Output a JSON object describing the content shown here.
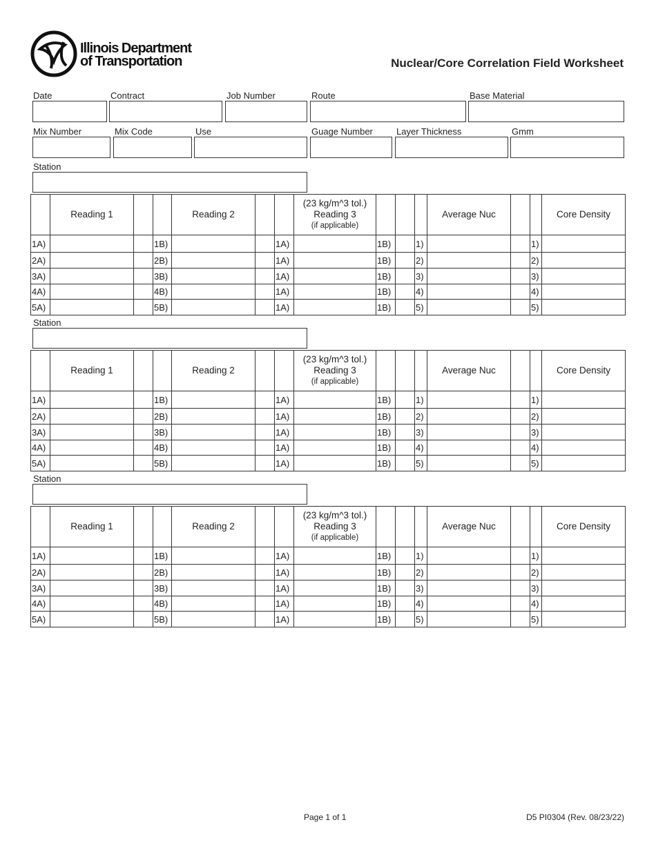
{
  "header": {
    "org_line1": "Illinois Department",
    "org_line2": "of Transportation",
    "title": "Nuclear/Core Correlation Field Worksheet"
  },
  "fields_row1": [
    {
      "label": "Date",
      "value": ""
    },
    {
      "label": "Contract",
      "value": ""
    },
    {
      "label": "Job Number",
      "value": ""
    },
    {
      "label": "Route",
      "value": ""
    },
    {
      "label": "Base Material",
      "value": ""
    }
  ],
  "fields_row2": [
    {
      "label": "Mix Number",
      "value": ""
    },
    {
      "label": "Mix Code",
      "value": ""
    },
    {
      "label": "Use",
      "value": ""
    },
    {
      "label": "Guage Number",
      "value": ""
    },
    {
      "label": "Layer Thickness",
      "value": ""
    },
    {
      "label": "Gmm",
      "value": ""
    }
  ],
  "station_label": "Station",
  "table_headers": {
    "reading1": "Reading 1",
    "reading2": "Reading 2",
    "reading3_tol": "(23 kg/m^3 tol.)",
    "reading3": "Reading 3",
    "reading3_note": "(if applicable)",
    "average_nuc": "Average Nuc",
    "core_density": "Core Density"
  },
  "row_labels": [
    {
      "r1": "1A)",
      "r2": "1B)",
      "r3a": "1A)",
      "r3b": "1B)",
      "avg": "1)",
      "core": "1)"
    },
    {
      "r1": "2A)",
      "r2": "2B)",
      "r3a": "1A)",
      "r3b": "1B)",
      "avg": "2)",
      "core": "2)"
    },
    {
      "r1": "3A)",
      "r2": "3B)",
      "r3a": "1A)",
      "r3b": "1B)",
      "avg": "3)",
      "core": "3)"
    },
    {
      "r1": "4A)",
      "r2": "4B)",
      "r3a": "1A)",
      "r3b": "1B)",
      "avg": "4)",
      "core": "4)"
    },
    {
      "r1": "5A)",
      "r2": "5B)",
      "r3a": "1A)",
      "r3b": "1B)",
      "avg": "5)",
      "core": "5)"
    }
  ],
  "sections": [
    {
      "station": ""
    },
    {
      "station": ""
    },
    {
      "station": ""
    }
  ],
  "footer": {
    "page": "Page 1 of 1",
    "form_id": "D5 PI0304 (Rev. 08/23/22)"
  }
}
